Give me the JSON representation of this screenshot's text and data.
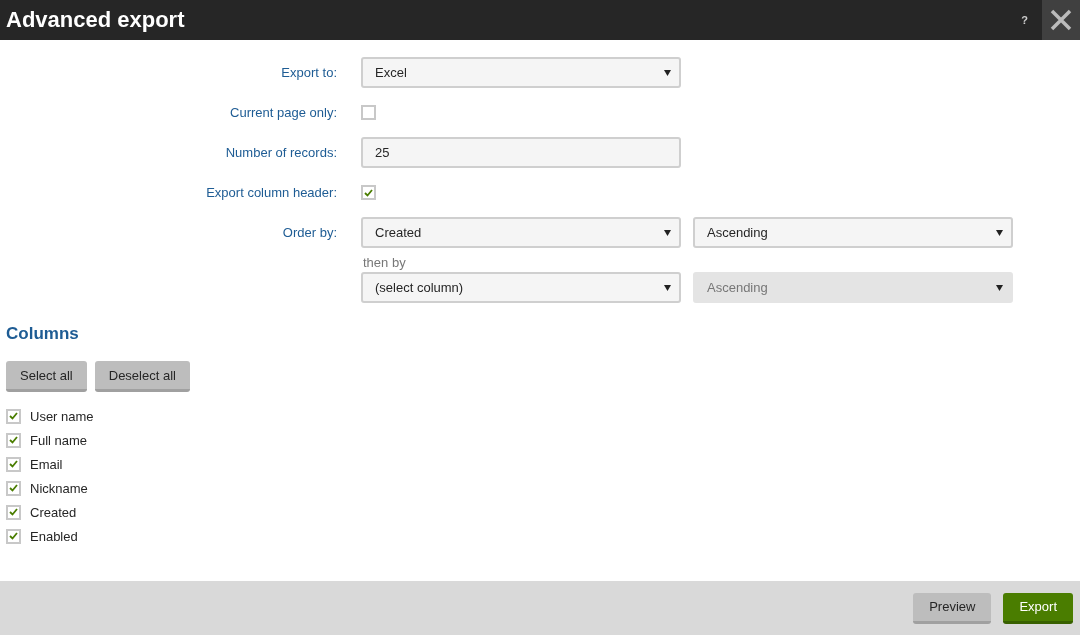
{
  "window": {
    "title": "Advanced export",
    "help": "?"
  },
  "form": [
    {
      "kind": "select",
      "label": "Export to:",
      "value": "Excel"
    },
    {
      "kind": "checkbox",
      "label": "Current page only:",
      "checked": false
    },
    {
      "kind": "text",
      "label": "Number of records:",
      "value": "25"
    },
    {
      "kind": "checkbox",
      "label": "Export column header:",
      "checked": true
    },
    {
      "kind": "order",
      "label": "Order by:",
      "column": "Created",
      "direction": "Ascending"
    }
  ],
  "then_by": {
    "label": "then by",
    "column": "(select column)",
    "direction": "Ascending",
    "direction_disabled": true
  },
  "columns": {
    "title": "Columns",
    "buttons": [
      "Select all",
      "Deselect all"
    ],
    "items": [
      {
        "label": "User name",
        "checked": true
      },
      {
        "label": "Full name",
        "checked": true
      },
      {
        "label": "Email",
        "checked": true
      },
      {
        "label": "Nickname",
        "checked": true
      },
      {
        "label": "Created",
        "checked": true
      },
      {
        "label": "Enabled",
        "checked": true
      }
    ]
  },
  "footer": {
    "buttons": [
      {
        "label": "Preview",
        "kind": "secondary"
      },
      {
        "label": "Export",
        "kind": "primary"
      }
    ]
  }
}
